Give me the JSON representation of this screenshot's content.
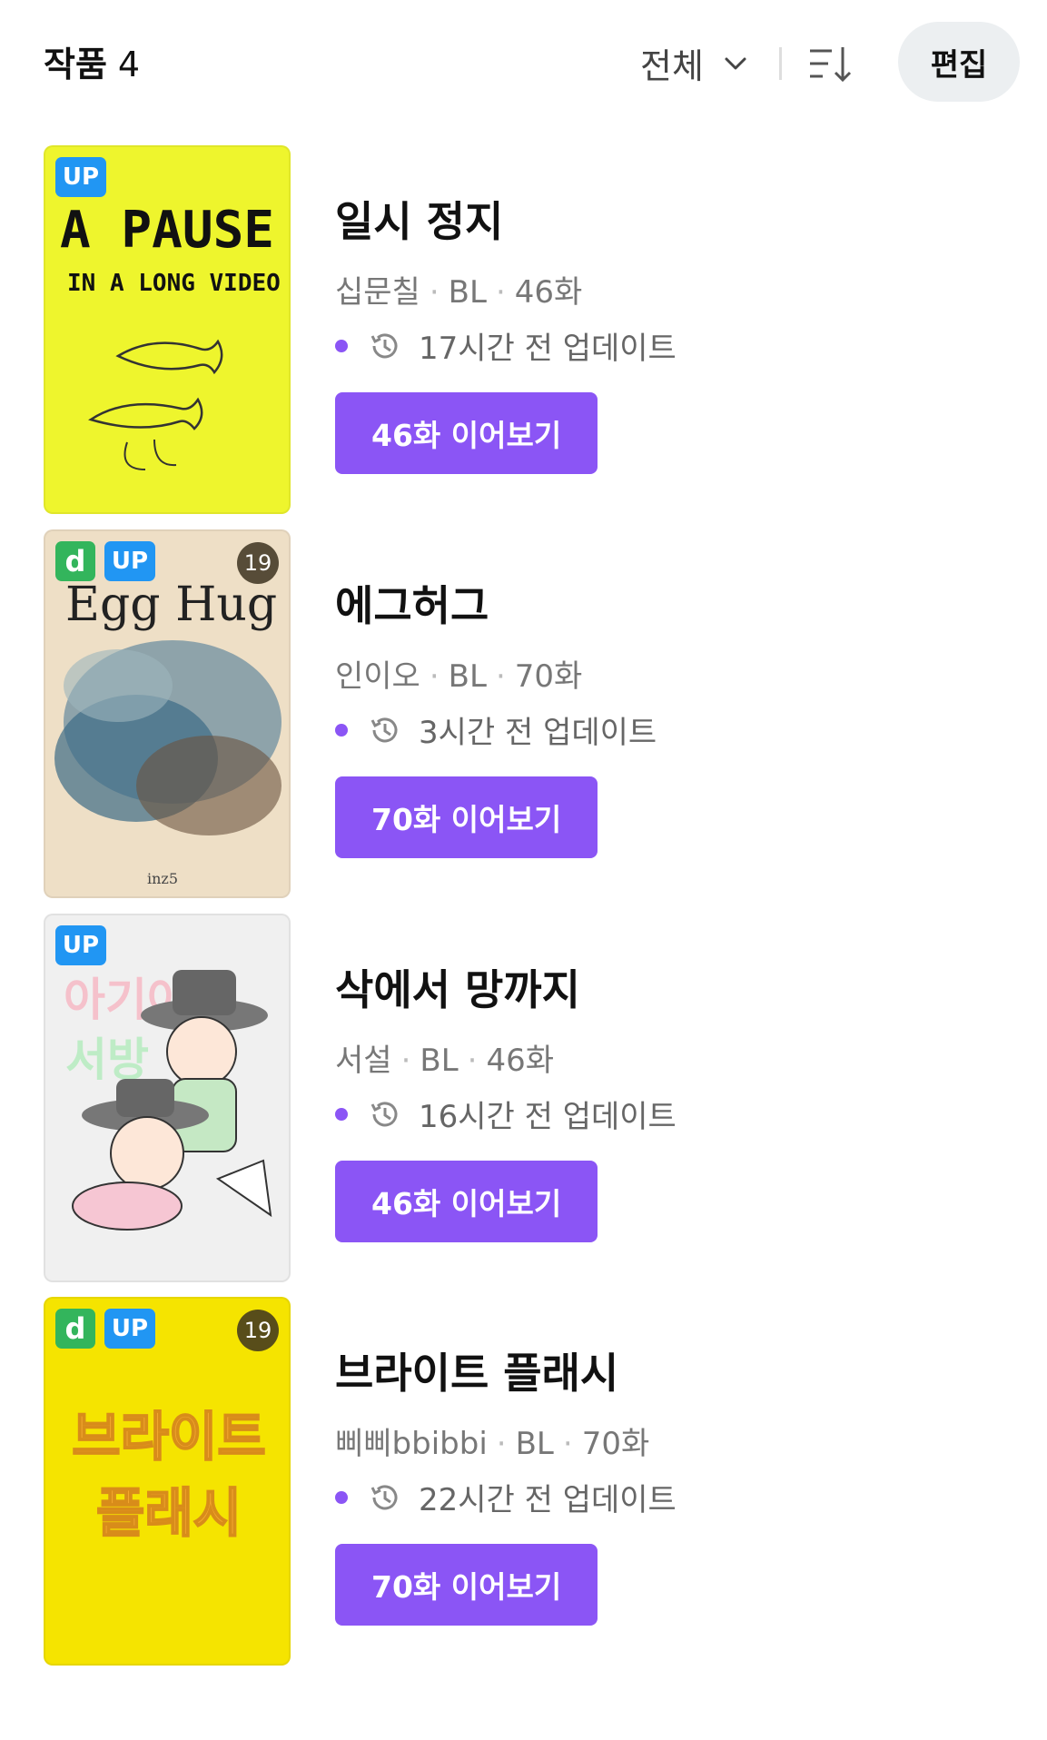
{
  "header": {
    "title": "작품",
    "count": "4",
    "filter_label": "전체",
    "edit_label": "편집"
  },
  "colors": {
    "accent": "#8b55f5",
    "up_badge": "#2196f3",
    "d_badge": "#33b55c"
  },
  "works": [
    {
      "title": "일시 정지",
      "author": "십문칠",
      "genre": "BL",
      "episodes": "46화",
      "updated": "17시간 전 업데이트",
      "continue_label": "46화 이어보기",
      "badges": [
        "UP"
      ],
      "cover_text": [
        "A PAUSE",
        "IN A LONG VIDEO"
      ]
    },
    {
      "title": "에그허그",
      "author": "인이오",
      "genre": "BL",
      "episodes": "70화",
      "updated": "3시간 전 업데이트",
      "continue_label": "70화 이어보기",
      "badges": [
        "d",
        "UP",
        "19"
      ],
      "cover_text": [
        "Egg Hug",
        "inz5"
      ]
    },
    {
      "title": "삭에서 망까지",
      "author": "서설",
      "genre": "BL",
      "episodes": "46화",
      "updated": "16시간 전 업데이트",
      "continue_label": "46화 이어보기",
      "badges": [
        "UP"
      ],
      "cover_text": [
        "아기야",
        "서방"
      ]
    },
    {
      "title": "브라이트 플래시",
      "author": "삐삐bbibbi",
      "genre": "BL",
      "episodes": "70화",
      "updated": "22시간 전 업데이트",
      "continue_label": "70화 이어보기",
      "badges": [
        "d",
        "UP",
        "19"
      ],
      "cover_text": [
        "브라이트",
        "플래시"
      ]
    }
  ]
}
